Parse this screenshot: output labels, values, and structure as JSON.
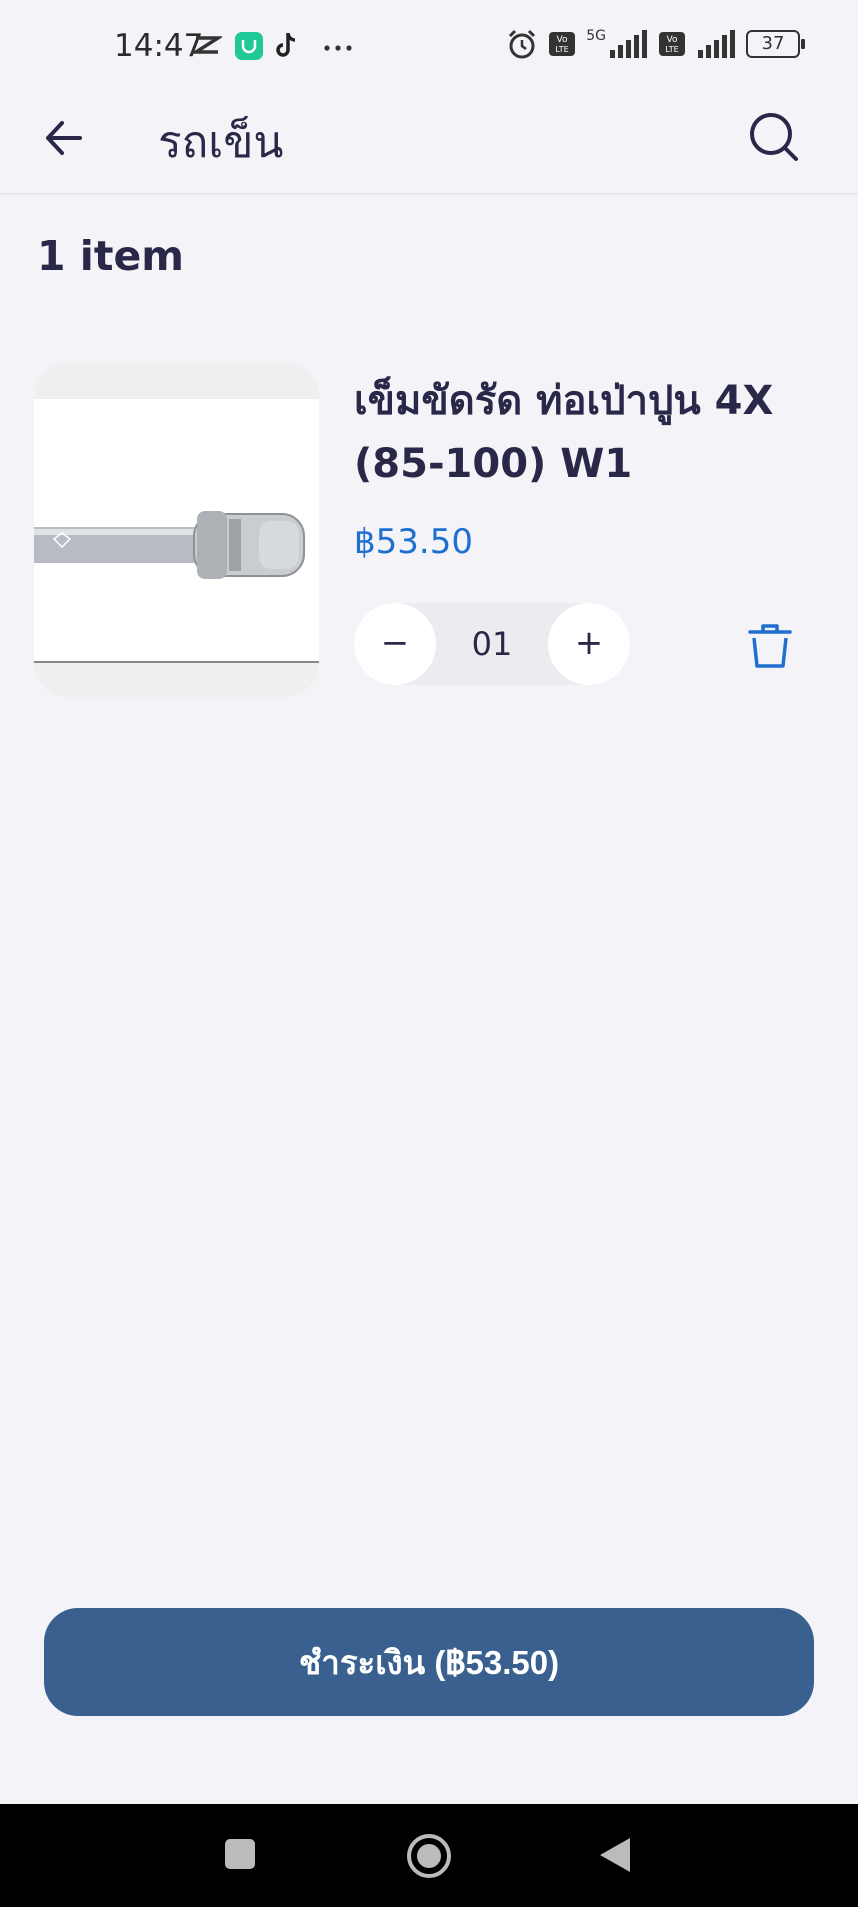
{
  "status_bar": {
    "time": "14:47",
    "network_label": "5G",
    "battery": "37"
  },
  "app_bar": {
    "title": "รถเข็น",
    "back_icon": "arrow-left-icon",
    "search_icon": "search-icon"
  },
  "cart": {
    "item_count": "1 item",
    "items": [
      {
        "name": "เข็มขัดรัด ท่อเป่าปูน 4X (85-100) W1",
        "price": "฿53.50",
        "quantity": "01",
        "decrement_label": "−",
        "increment_label": "+"
      }
    ]
  },
  "checkout": {
    "label": "ชำระเงิน (฿53.50)"
  },
  "colors": {
    "accent": "#1e6fd0",
    "checkout_button": "#3a608f",
    "title_text": "#2a2848",
    "background": "#f4f4f8"
  }
}
